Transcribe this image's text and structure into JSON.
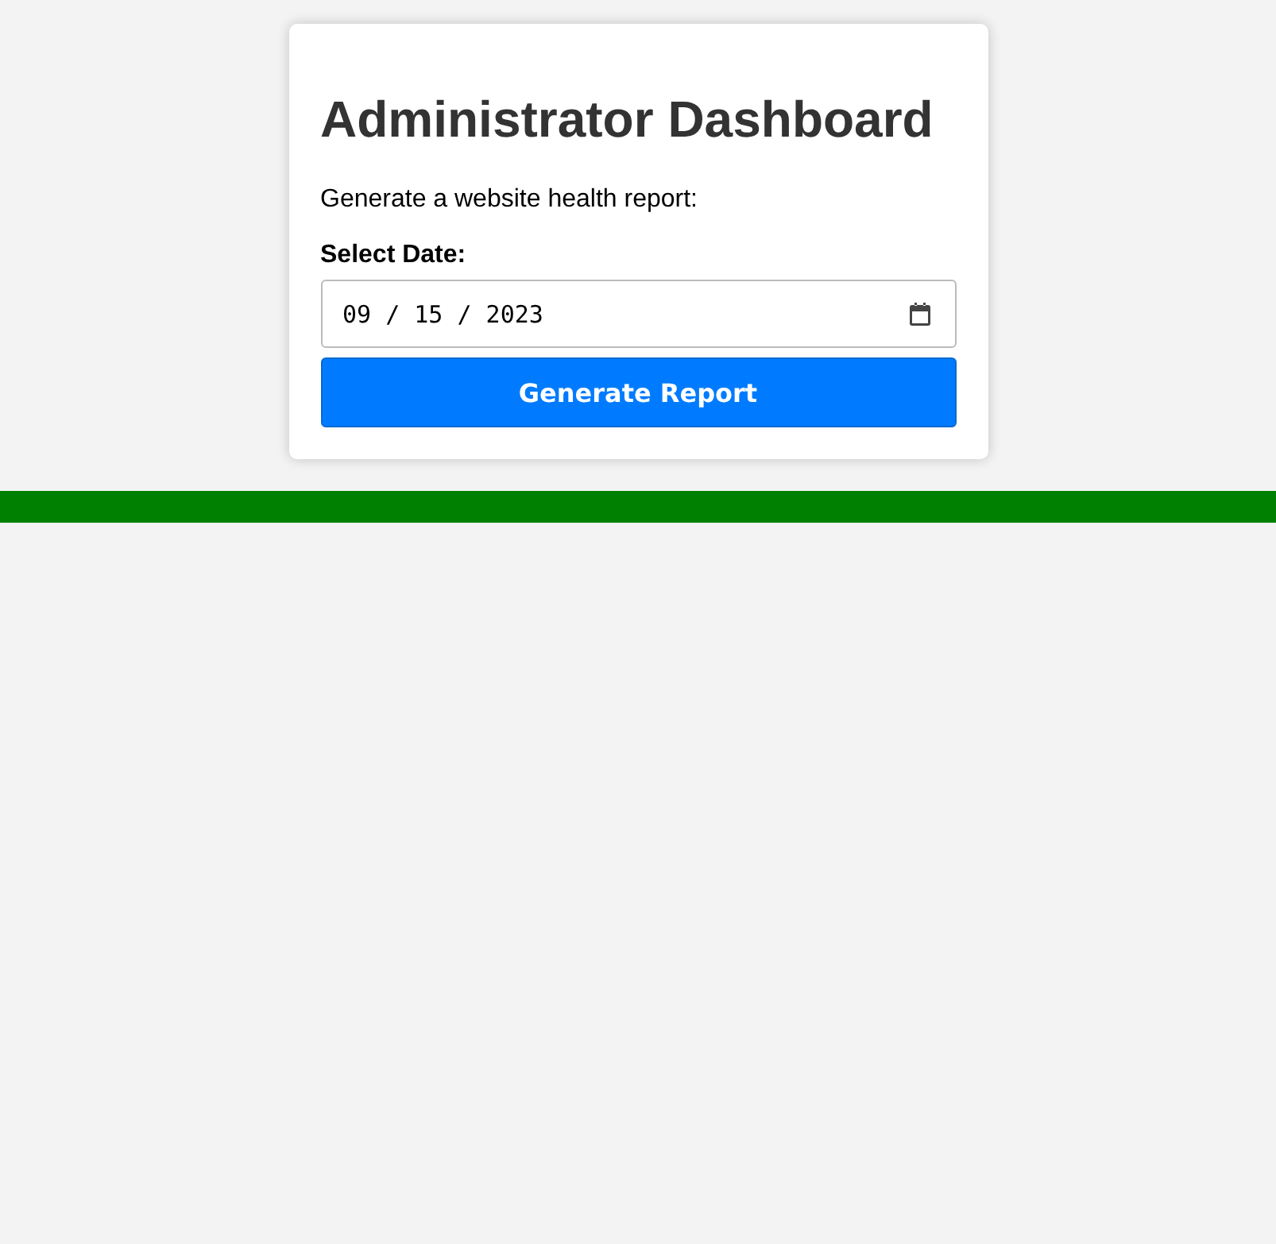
{
  "title": "Administrator Dashboard",
  "description": "Generate a website health report:",
  "date_field": {
    "label": "Select Date:",
    "value": "09 / 15 / 2023"
  },
  "button": "Generate Report"
}
